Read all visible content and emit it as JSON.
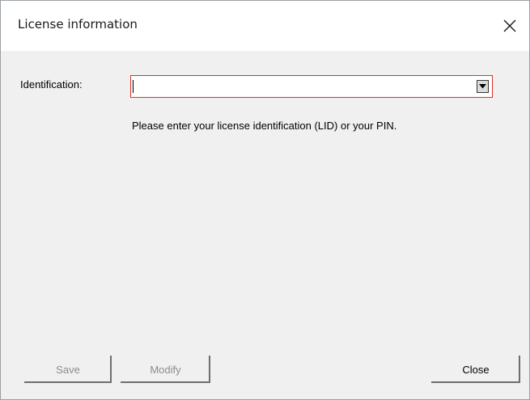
{
  "window": {
    "title": "License information"
  },
  "form": {
    "identification_label": "Identification:",
    "identification_value": "",
    "hint": "Please enter your license identification (LID) or your PIN."
  },
  "buttons": {
    "save": "Save",
    "modify": "Modify",
    "close": "Close"
  },
  "colors": {
    "content_background": "#f0f0f0",
    "title_background": "#ffffff",
    "focus_border": "#d9342b",
    "disabled_text": "#8c8c8c"
  },
  "icons": {
    "close": "close-icon",
    "dropdown": "dropdown-arrow-icon"
  }
}
